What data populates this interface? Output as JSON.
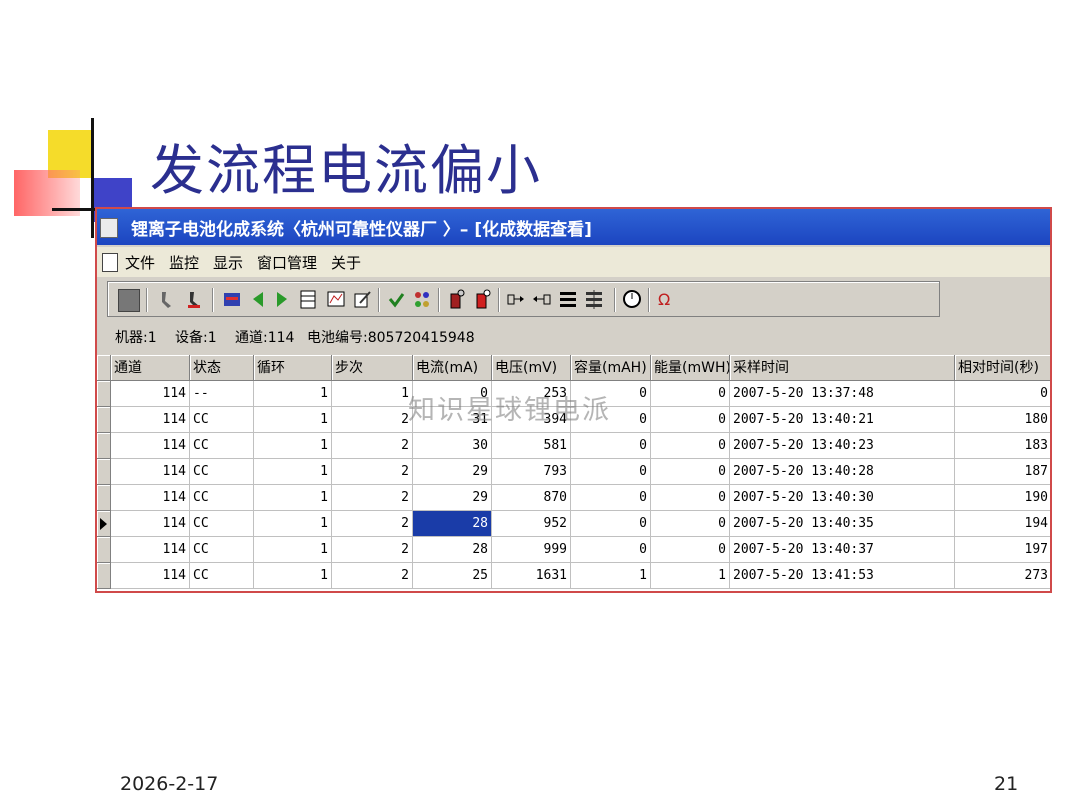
{
  "slide": {
    "title": "发流程电流偏小",
    "date": "2026-2-17",
    "page": "21",
    "watermark": "知识星球锂电派"
  },
  "window": {
    "title": "锂离子电池化成系统〈杭州可靠性仪器厂 〉– [化成数据查看]"
  },
  "menu": {
    "items": [
      {
        "label": "文件"
      },
      {
        "label": "监控"
      },
      {
        "label": "显示"
      },
      {
        "label": "窗口管理"
      },
      {
        "label": "关于"
      }
    ]
  },
  "toolbar": {
    "icons": [
      "stop-icon",
      "walk-icon",
      "walk-red-icon",
      "chart-icon",
      "back-arrow-icon",
      "forward-arrow-icon",
      "table-icon",
      "graph-icon",
      "edit-icon",
      "check-icon",
      "group-icon",
      "battery-icon",
      "battery-red-icon",
      "link-icon",
      "split-icon",
      "stack-icon",
      "stack-alt-icon",
      "clock-icon",
      "omega-icon"
    ]
  },
  "info": {
    "machine": "机器:1",
    "device": "设备:1",
    "channel": "通道:114",
    "battery": "电池编号:805720415948"
  },
  "table": {
    "columns": [
      "通道",
      "状态",
      "循环",
      "步次",
      "电流(mA)",
      "电压(mV)",
      "容量(mAH)",
      "能量(mWH)",
      "采样时间",
      "相对时间(秒)"
    ],
    "rows": [
      [
        "114",
        "--",
        "1",
        "1",
        "0",
        "253",
        "0",
        "0",
        "2007-5-20 13:37:48",
        "0"
      ],
      [
        "114",
        "CC",
        "1",
        "2",
        "31",
        "394",
        "0",
        "0",
        "2007-5-20 13:40:21",
        "180"
      ],
      [
        "114",
        "CC",
        "1",
        "2",
        "30",
        "581",
        "0",
        "0",
        "2007-5-20 13:40:23",
        "183"
      ],
      [
        "114",
        "CC",
        "1",
        "2",
        "29",
        "793",
        "0",
        "0",
        "2007-5-20 13:40:28",
        "187"
      ],
      [
        "114",
        "CC",
        "1",
        "2",
        "29",
        "870",
        "0",
        "0",
        "2007-5-20 13:40:30",
        "190"
      ],
      [
        "114",
        "CC",
        "1",
        "2",
        "28",
        "952",
        "0",
        "0",
        "2007-5-20 13:40:35",
        "194"
      ],
      [
        "114",
        "CC",
        "1",
        "2",
        "28",
        "999",
        "0",
        "0",
        "2007-5-20 13:40:37",
        "197"
      ],
      [
        "114",
        "CC",
        "1",
        "2",
        "25",
        "1631",
        "1",
        "1",
        "2007-5-20 13:41:53",
        "273"
      ]
    ],
    "current_row": 5,
    "selected_column": 4
  },
  "colors": {
    "title": "#2b2f8f",
    "titlebar": "#1c45c0",
    "selection": "#1a3ca8",
    "window_border": "#d04a4a"
  }
}
